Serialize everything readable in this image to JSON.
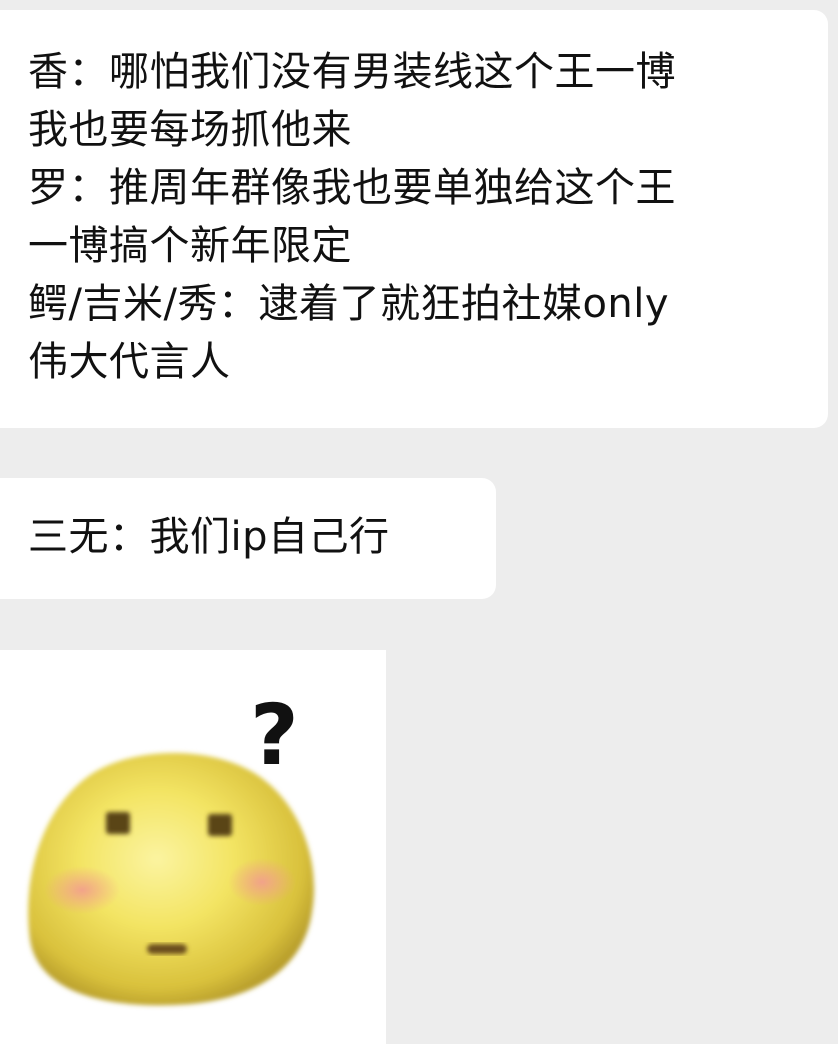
{
  "messages": [
    {
      "type": "text",
      "lines": [
        "香：哪怕我们没有男装线这个王一博",
        "我也要每场抓他来",
        "罗：推周年群像我也要单独给这个王",
        "一博搞个新年限定",
        "鳄/吉米/秀：逮着了就狂拍社媒only",
        "伟大代言人"
      ]
    },
    {
      "type": "text",
      "lines": [
        "三无：我们ip自己行"
      ]
    },
    {
      "type": "sticker",
      "icon": "confused-blushing-face-sticker",
      "glyph": "?"
    }
  ],
  "colors": {
    "background": "#ededed",
    "bubble": "#ffffff",
    "text": "#111111",
    "face": "#f2e25d",
    "blush": "#f0a98f"
  }
}
